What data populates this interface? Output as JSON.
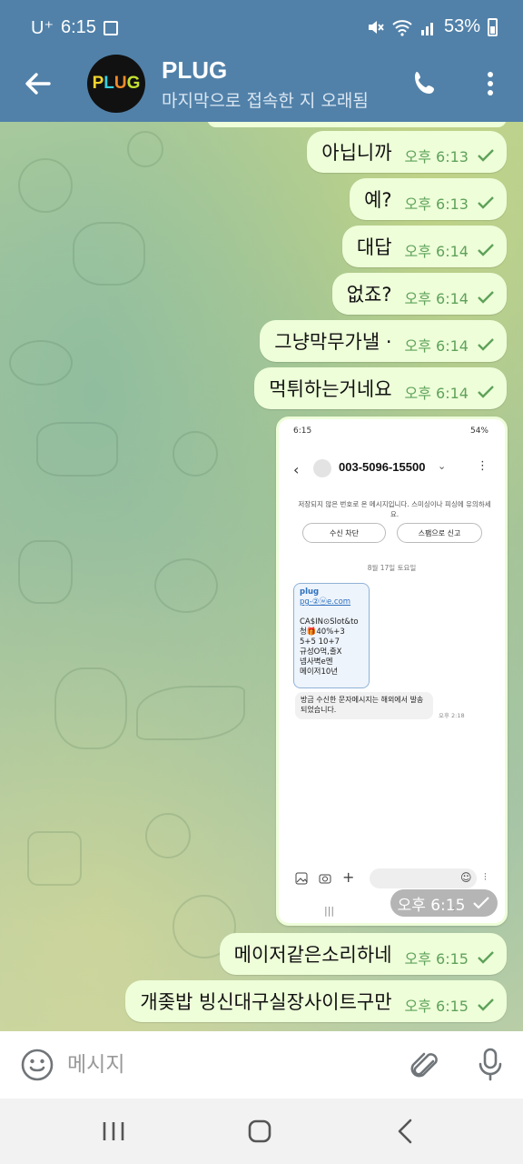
{
  "status_bar": {
    "carrier": "U⁺",
    "time": "6:15",
    "battery": "53%"
  },
  "header": {
    "title": "PLUG",
    "subtitle": "마지막으로 접속한 지 오래됨",
    "avatar_text": [
      "P",
      "L",
      "U",
      "G"
    ]
  },
  "messages": [
    {
      "text": "아닙니까",
      "time": "오후 6:13"
    },
    {
      "text": "예?",
      "time": "오후 6:13"
    },
    {
      "text": "대답",
      "time": "오후 6:14"
    },
    {
      "text": "없죠?",
      "time": "오후 6:14"
    },
    {
      "text": "그냥막무가낼 ·",
      "time": "오후 6:14"
    },
    {
      "text": "먹튀하는거네요",
      "time": "오후 6:14"
    },
    {
      "text": "메이저같은소리하네",
      "time": "오후 6:15"
    },
    {
      "text": "개좆밥 빙신대구실장사이트구만",
      "time": "오후 6:15"
    }
  ],
  "image_message": {
    "time": "오후 6:15",
    "screenshot": {
      "status_time": "6:15",
      "status_right": "54%",
      "phone_number": "003-5096-15500",
      "notice": "저장되지 않은 번호로 온 메시지입니다. 스미싱이나 피싱에 유의하세요.",
      "block_button": "수신 차단",
      "spam_button": "스팸으로 신고",
      "date": "8월 17일 토요일",
      "card_brand": "plug",
      "card_link": "pg-②ⓦe.com",
      "card_lines": [
        "CA$IN⊙Slot&to",
        "청🎁40%+3",
        "5+5 10+7",
        "규성O먹,출X",
        "넴사벽e멘",
        "메이저10년"
      ],
      "received_text": "방금 수신한 문자메시지는 해외에서 발송되었습니다.",
      "received_time": "오후 2:18"
    }
  },
  "input": {
    "placeholder": "메시지"
  },
  "colors": {
    "header": "#5181a9",
    "bubble": "#eefed9",
    "time_text": "#5fa25a"
  }
}
